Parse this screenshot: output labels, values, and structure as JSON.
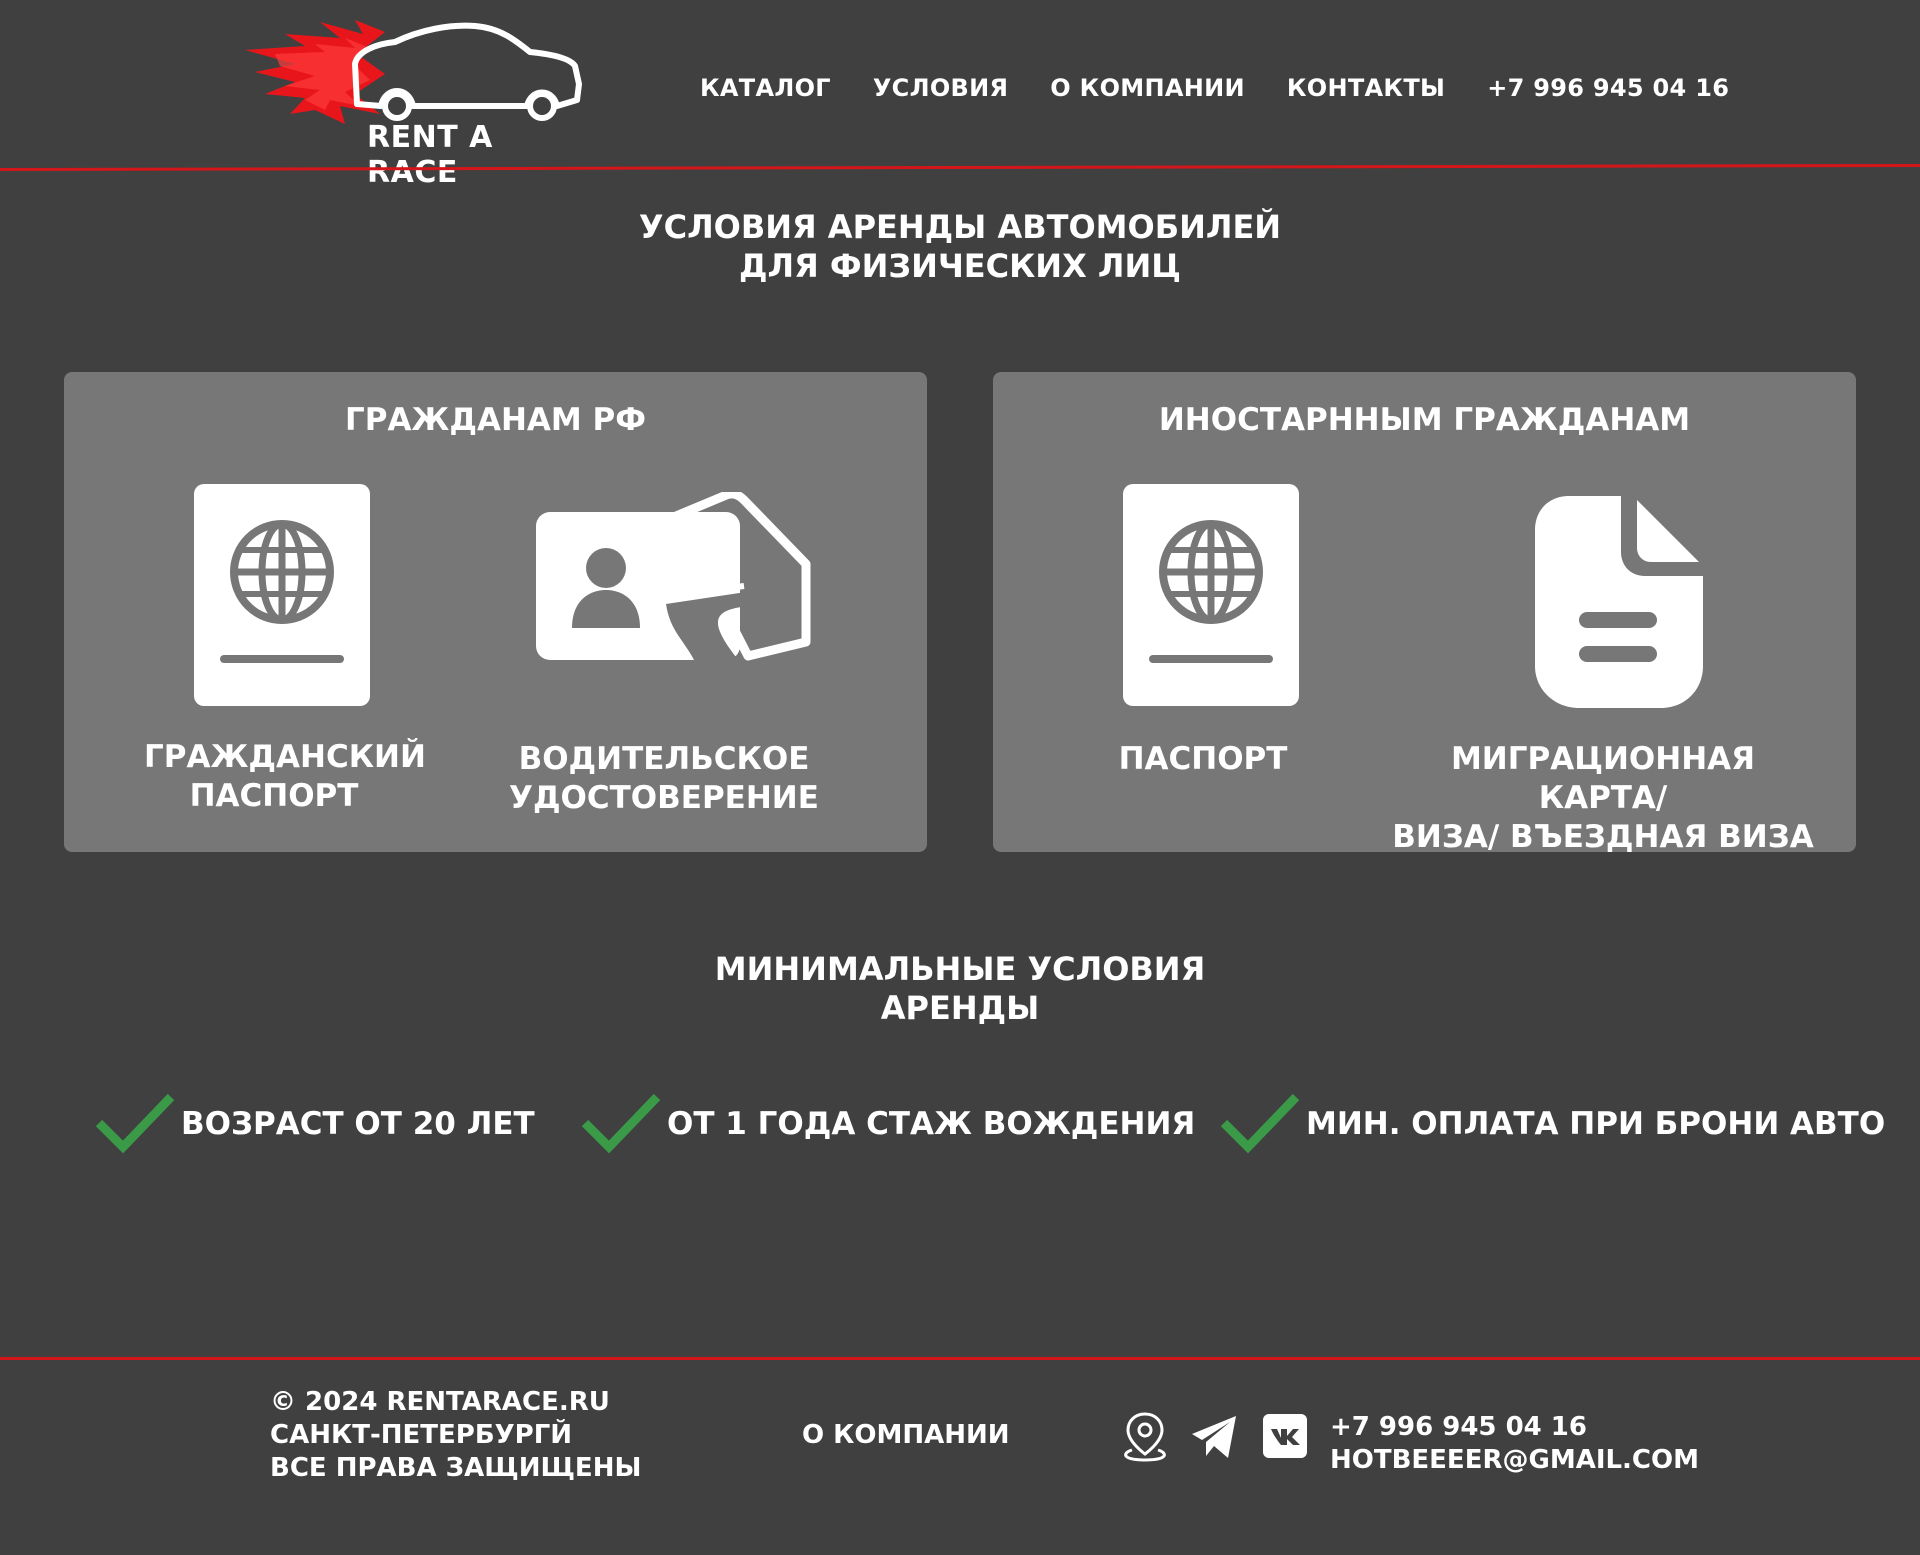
{
  "header": {
    "logo_text": "RENT A RACE",
    "nav": [
      "КАТАЛОГ",
      "УСЛОВИЯ",
      "О КОМПАНИИ",
      "КОНТАКТЫ",
      "+7 996 945 04 16"
    ]
  },
  "page_title": [
    "УСЛОВИЯ АРЕНДЫ АВТОМОБИЛЕЙ",
    "ДЛЯ ФИЗИЧЕСКИХ ЛИЦ"
  ],
  "cards": [
    {
      "title": "ГРАЖДАНАМ РФ",
      "docs": [
        {
          "icon": "passport-icon",
          "label": [
            "ГРАЖДАНСКИЙ",
            "ПАСПОРТ"
          ]
        },
        {
          "icon": "driver-license-icon",
          "label": [
            "ВОДИТЕЛЬСКОЕ",
            "УДОСТОВЕРЕНИЕ"
          ]
        }
      ]
    },
    {
      "title": "ИНОСТАРННЫМ ГРАЖДАНАМ",
      "docs": [
        {
          "icon": "passport-icon",
          "label": [
            "ПАСПОРТ"
          ]
        },
        {
          "icon": "document-icon",
          "label": [
            "МИГРАЦИОННАЯ КАРТА/",
            "ВИЗА/ ВЪЕЗДНАЯ ВИЗА"
          ]
        }
      ]
    }
  ],
  "min_conditions_title": [
    "МИНИМАЛЬНЫЕ УСЛОВИЯ",
    "АРЕНДЫ"
  ],
  "conditions": [
    "ВОЗРАСТ ОТ 20 ЛЕТ",
    "ОТ 1 ГОДА СТАЖ ВОЖДЕНИЯ",
    "МИН. ОПЛАТА ПРИ БРОНИ АВТО"
  ],
  "footer": {
    "copyright": "© 2024 RENTARACE.RU",
    "city": "САНКТ-ПЕТЕРБУРГЙ",
    "rights": "ВСЕ ПРАВА ЗАЩИЩЕНЫ",
    "about_link": "О КОМПАНИИ",
    "phone": "+7 996 945 04 16",
    "email": "HOTBEEEER@GMAIL.COM",
    "icons": [
      "location-pin-icon",
      "telegram-icon",
      "vk-icon"
    ]
  },
  "colors": {
    "background": "#404040",
    "card": "#777777",
    "accent_red": "#d4161a",
    "check_green": "#3a9a48",
    "icon_gray": "#777777"
  }
}
